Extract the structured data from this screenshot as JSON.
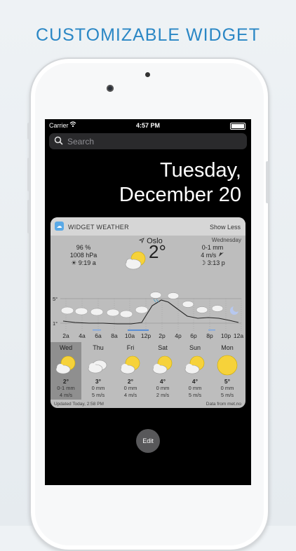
{
  "promo": {
    "title": "CUSTOMIZABLE WIDGET"
  },
  "status_bar": {
    "carrier": "Carrier",
    "wifi_icon": "wifi-icon",
    "time": "4:57 PM",
    "battery_icon": "battery-icon"
  },
  "search": {
    "placeholder": "Search",
    "icon": "search-icon"
  },
  "date": {
    "weekday": "Tuesday,",
    "day": "December 20"
  },
  "widget": {
    "app_name": "WIDGET WEATHER",
    "toggle_label": "Show Less",
    "current": {
      "day_name": "Wednesday",
      "humidity": "96 %",
      "pressure": "1008 hPa",
      "sunrise": "☀ 9:19 a",
      "city": "Oslo",
      "location_icon": "location-arrow-icon",
      "temperature": "2°",
      "precipitation": "0-1 mm",
      "wind": "4 m/s",
      "wind_icon": "wind-direction-icon",
      "moonrise": "☽ 3:13 p",
      "condition_icon": "sun-cloud-icon"
    },
    "graph": {
      "y_top_label": "5°",
      "y_bottom_label": "1°",
      "hours": [
        "2a",
        "4a",
        "6a",
        "8a",
        "10a",
        "12p",
        "2p",
        "4p",
        "6p",
        "8p",
        "10p",
        "12a"
      ]
    },
    "forecast": [
      {
        "name": "Wed",
        "temp": "2°",
        "precip": "0-1 mm",
        "wind": "4 m/s",
        "icon": "sun-cloud-icon"
      },
      {
        "name": "Thu",
        "temp": "3°",
        "precip": "0 mm",
        "wind": "5 m/s",
        "icon": "cloud-icon"
      },
      {
        "name": "Fri",
        "temp": "2°",
        "precip": "0 mm",
        "wind": "4 m/s",
        "icon": "sun-cloud-icon"
      },
      {
        "name": "Sat",
        "temp": "4°",
        "precip": "0 mm",
        "wind": "2 m/s",
        "icon": "sun-cloud-icon"
      },
      {
        "name": "Sun",
        "temp": "4°",
        "precip": "0 mm",
        "wind": "5 m/s",
        "icon": "sun-cloud-icon"
      },
      {
        "name": "Mon",
        "temp": "5°",
        "precip": "0 mm",
        "wind": "5 m/s",
        "icon": "sun-icon"
      }
    ],
    "updated": "Updated Today, 2:58 PM",
    "source": "Data from met.no"
  },
  "edit_label": "Edit",
  "colors": {
    "accent": "#2a87c5",
    "sun": "#f6d23a",
    "cloud": "#f2f2f2",
    "moon": "#b7c8ef"
  }
}
